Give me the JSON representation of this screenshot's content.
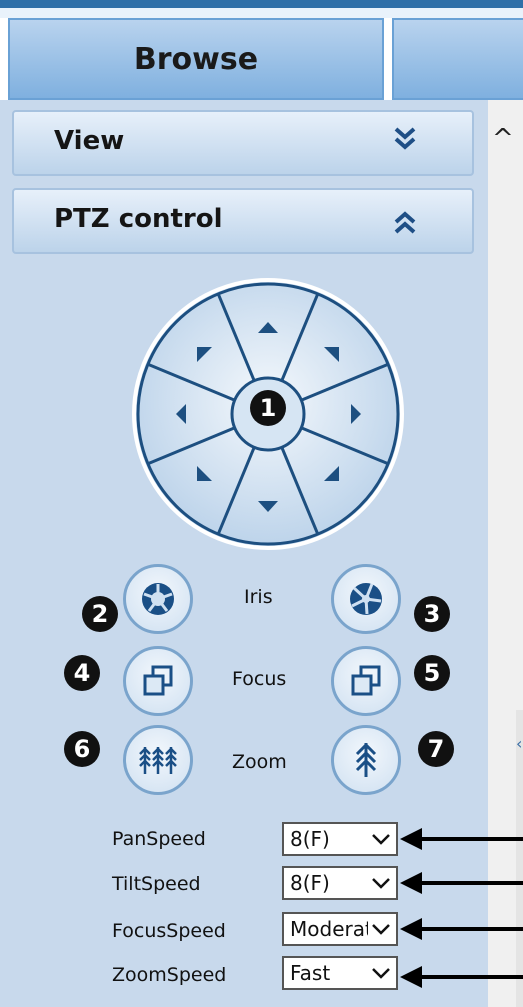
{
  "tabs": [
    {
      "label": "Browse",
      "active": true
    }
  ],
  "sections": [
    {
      "label": "View",
      "state": "collapsed",
      "icon": "double-chevron-down-icon"
    },
    {
      "label": "PTZ control",
      "state": "expanded",
      "icon": "double-chevron-up-icon"
    }
  ],
  "dial": {
    "center_badge": "1"
  },
  "controls": {
    "iris": {
      "label": "Iris",
      "left_badge": "2",
      "right_badge": "3"
    },
    "focus": {
      "label": "Focus",
      "left_badge": "4",
      "right_badge": "5"
    },
    "zoom": {
      "label": "Zoom",
      "left_badge": "6",
      "right_badge": "7"
    }
  },
  "speeds": [
    {
      "label": "PanSpeed",
      "value": "8(F)"
    },
    {
      "label": "TiltSpeed",
      "value": "8(F)"
    },
    {
      "label": "FocusSpeed",
      "value": "Moderate"
    },
    {
      "label": "ZoomSpeed",
      "value": "Fast"
    }
  ],
  "colors": {
    "accent": "#1f5f95",
    "panel": "#c8d9ec",
    "tab": "#7fb0df"
  }
}
